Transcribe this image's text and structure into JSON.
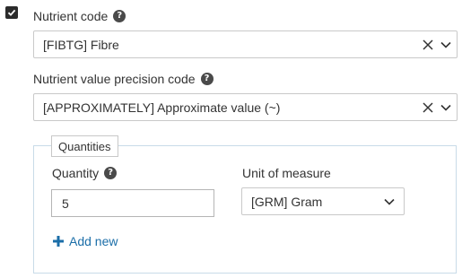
{
  "nutrient_code": {
    "label": "Nutrient code",
    "value": "[FIBTG] Fibre"
  },
  "precision_code": {
    "label": "Nutrient value precision code",
    "value": "[APPROXIMATELY] Approximate value (~)"
  },
  "quantities": {
    "legend": "Quantities",
    "quantity_label": "Quantity",
    "quantity_value": "5",
    "unit_label": "Unit of measure",
    "unit_value": "[GRM] Gram",
    "add_new_label": "Add new"
  },
  "colors": {
    "accent": "#1b6ea8",
    "checkbox": "#2b2b2b"
  },
  "icons": {
    "help": "?",
    "clear": "close-icon",
    "dropdown": "chevron-down-icon",
    "add": "plus-icon"
  }
}
